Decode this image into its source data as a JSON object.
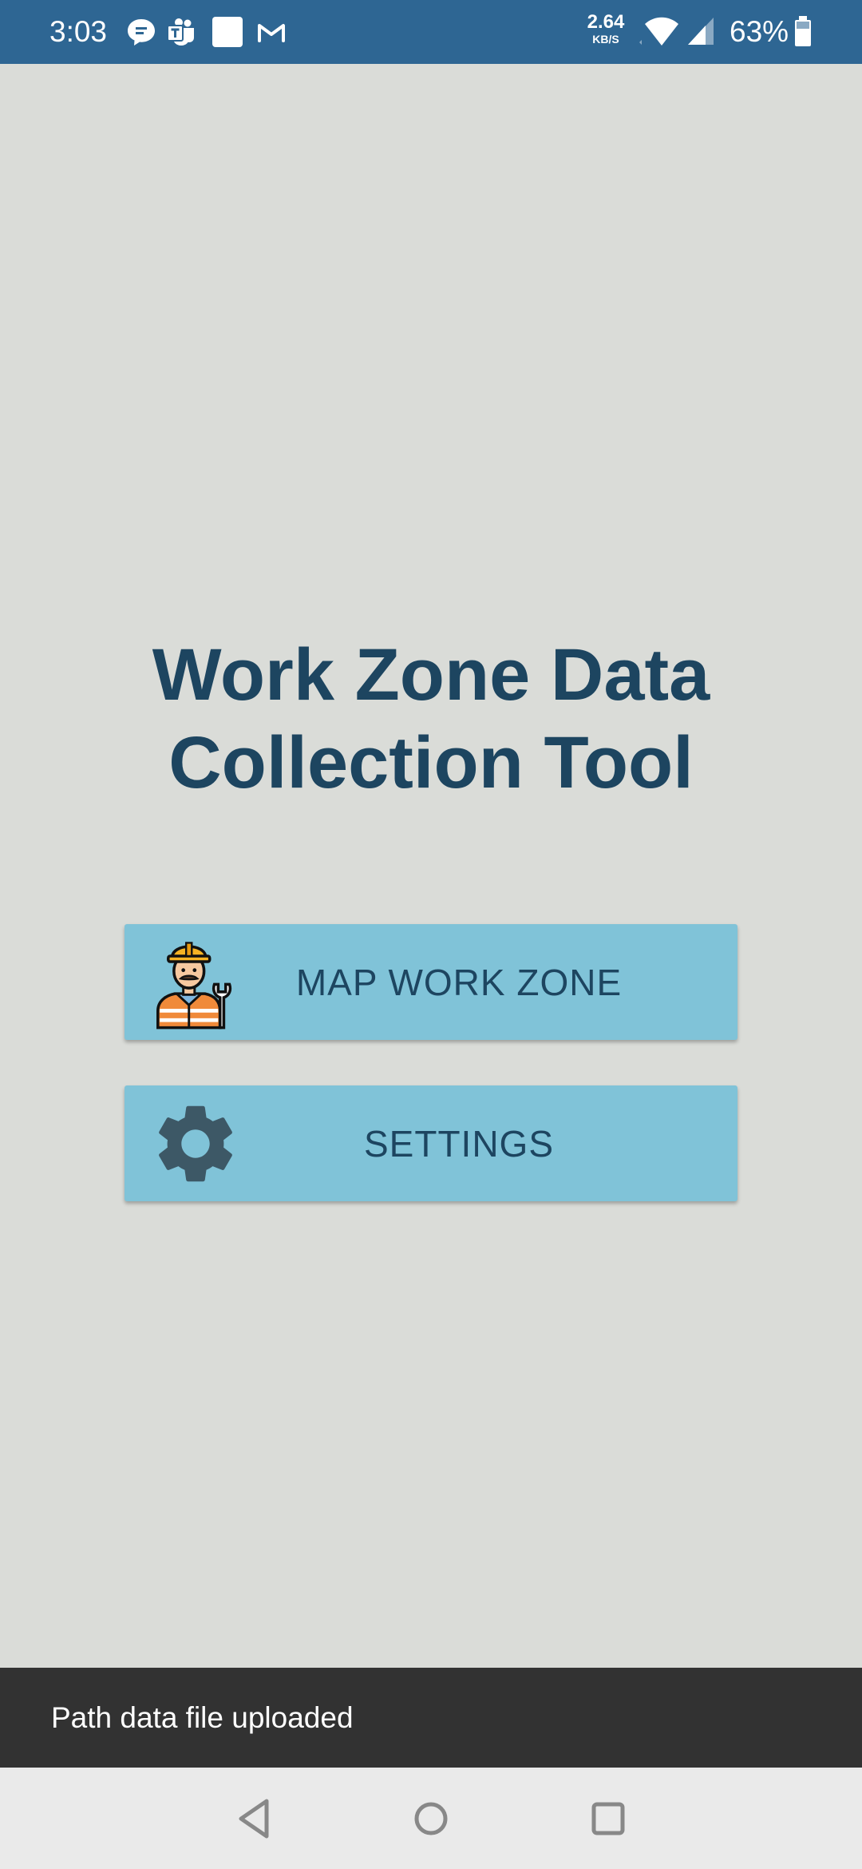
{
  "status_bar": {
    "time": "3:03",
    "notification_icons": [
      "chat-bubble-icon",
      "teams-icon",
      "blank-square-icon",
      "gmail-icon"
    ],
    "net_speed_value": "2.64",
    "net_speed_unit": "KB/S",
    "wifi_icon": "wifi-icon",
    "signal_icon": "cell-signal-icon",
    "battery_percent": "63%",
    "battery_icon": "battery-icon"
  },
  "main": {
    "title_line1": "Work Zone Data",
    "title_line2": "Collection Tool",
    "buttons": [
      {
        "label": "MAP WORK ZONE",
        "icon": "construction-worker-icon"
      },
      {
        "label": "SETTINGS",
        "icon": "gear-icon"
      }
    ]
  },
  "snackbar": {
    "message": "Path data file uploaded"
  },
  "nav_bar": {
    "icons": [
      "back-icon",
      "home-icon",
      "recents-icon"
    ]
  },
  "colors": {
    "status_bar": "#2e6693",
    "background": "#dadcd8",
    "button": "#80c3d8",
    "title_text": "#1d4560",
    "snackbar": "#323232",
    "nav_bar": "#eaeaea"
  }
}
